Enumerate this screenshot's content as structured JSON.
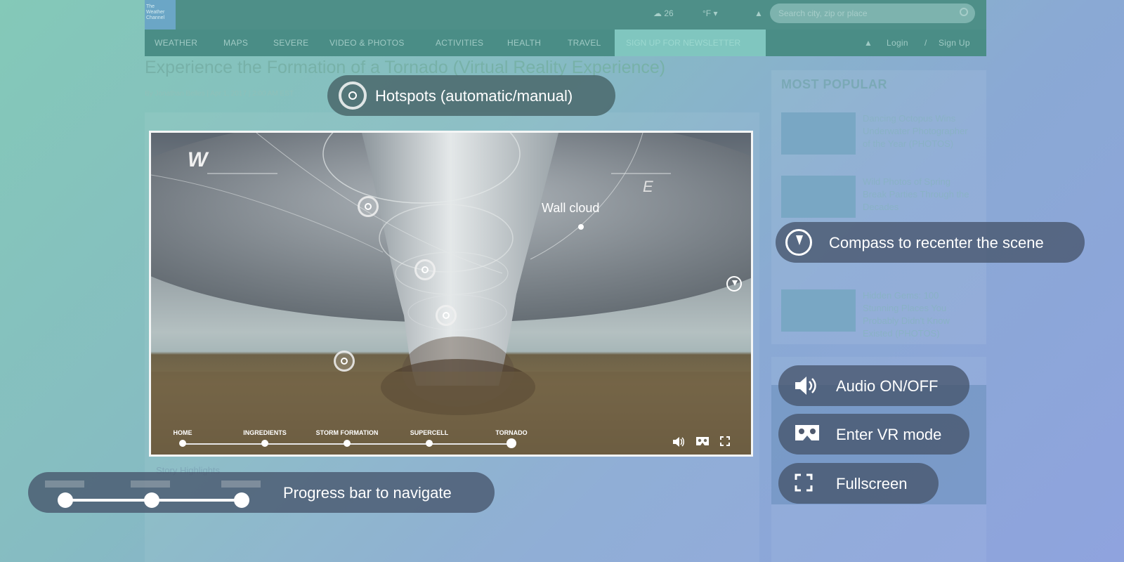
{
  "site": {
    "logo_text": "The Weather Channel",
    "temperature": "26",
    "unit": "°F",
    "search_placeholder": "Search city, zip or place",
    "nav": [
      "WEATHER",
      "MAPS",
      "SEVERE",
      "VIDEO & PHOTOS",
      "ACTIVITIES",
      "HEALTH",
      "TRAVEL"
    ],
    "newsletter": "SIGN UP FOR NEWSLETTER",
    "login": "Login",
    "signup": "Sign Up",
    "article_title": "Experience the Formation of a Tornado (Virtual Reality Experience)",
    "byline": "By Jonathan Belles | Apr 1, 2017 | 2:00 AM EST",
    "story_label": "Story Highlights",
    "most_popular": "MOST POPULAR",
    "popular": [
      {
        "text": "Dancing Octopus Wins Underwater Photographer of the Year (PHOTOS)"
      },
      {
        "text": "Wild Photos of Spring Break Parties Through the Decades"
      },
      {
        "text": "Hidden Gems: 100 Stunning Places You Probably Didn't Know Existed (PHOTOS)"
      }
    ]
  },
  "viewer": {
    "hotspot_label": "Wall cloud",
    "compass_w": "W",
    "compass_e": "E",
    "stages": [
      "HOME",
      "INGREDIENTS",
      "STORM FORMATION",
      "SUPERCELL",
      "TORNADO"
    ],
    "active_stage_index": 4,
    "controls": {
      "audio_icon": "speaker-icon",
      "vr_icon": "vr-headset-icon",
      "fullscreen_icon": "fullscreen-icon"
    }
  },
  "callouts": {
    "hotspots": "Hotspots (automatic/manual)",
    "compass": "Compass to recenter the scene",
    "audio": "Audio ON/OFF",
    "vr": "Enter VR mode",
    "fullscreen": "Fullscreen",
    "progress": "Progress bar to navigate"
  },
  "colors": {
    "background_teal": "#84c9b8",
    "background_blue": "#8fa3de",
    "callout_bg": "#46546b",
    "nav_teal": "#4a8d86"
  }
}
